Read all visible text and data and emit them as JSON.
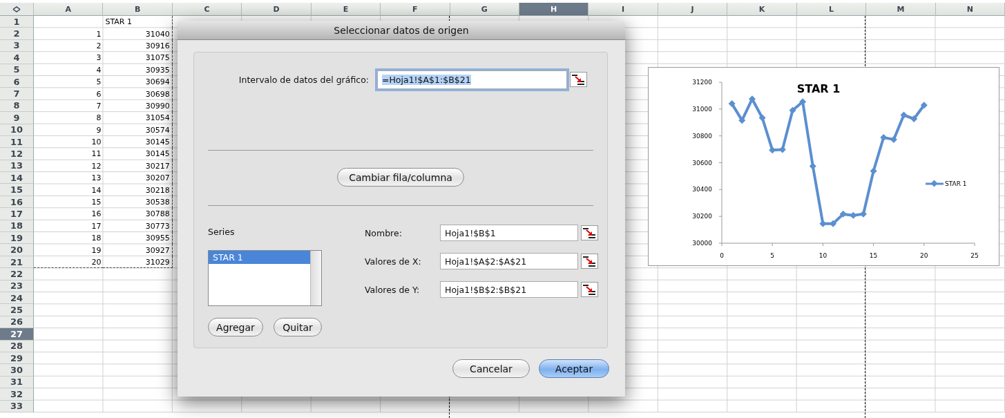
{
  "sheet": {
    "columns": [
      {
        "label": "A",
        "selected": false
      },
      {
        "label": "B",
        "selected": false
      },
      {
        "label": "C",
        "selected": false
      },
      {
        "label": "D",
        "selected": false
      },
      {
        "label": "E",
        "selected": false
      },
      {
        "label": "F",
        "selected": false
      },
      {
        "label": "G",
        "selected": false
      },
      {
        "label": "H",
        "selected": true
      },
      {
        "label": "I",
        "selected": false
      },
      {
        "label": "J",
        "selected": false
      },
      {
        "label": "K",
        "selected": false
      },
      {
        "label": "L",
        "selected": false
      },
      {
        "label": "M",
        "selected": false
      },
      {
        "label": "N",
        "selected": false
      }
    ],
    "rows": [
      {
        "label": "1",
        "selected": false,
        "b": "STAR 1"
      },
      {
        "label": "2",
        "selected": false,
        "a": "1",
        "b": "31040"
      },
      {
        "label": "3",
        "selected": false,
        "a": "2",
        "b": "30916"
      },
      {
        "label": "4",
        "selected": false,
        "a": "3",
        "b": "31075"
      },
      {
        "label": "5",
        "selected": false,
        "a": "4",
        "b": "30935"
      },
      {
        "label": "6",
        "selected": false,
        "a": "5",
        "b": "30694"
      },
      {
        "label": "7",
        "selected": false,
        "a": "6",
        "b": "30698"
      },
      {
        "label": "8",
        "selected": false,
        "a": "7",
        "b": "30990"
      },
      {
        "label": "9",
        "selected": false,
        "a": "8",
        "b": "31054"
      },
      {
        "label": "10",
        "selected": false,
        "a": "9",
        "b": "30574"
      },
      {
        "label": "11",
        "selected": false,
        "a": "10",
        "b": "30145"
      },
      {
        "label": "12",
        "selected": false,
        "a": "11",
        "b": "30145"
      },
      {
        "label": "13",
        "selected": false,
        "a": "12",
        "b": "30217"
      },
      {
        "label": "14",
        "selected": false,
        "a": "13",
        "b": "30207"
      },
      {
        "label": "15",
        "selected": false,
        "a": "14",
        "b": "30218"
      },
      {
        "label": "16",
        "selected": false,
        "a": "15",
        "b": "30538"
      },
      {
        "label": "17",
        "selected": false,
        "a": "16",
        "b": "30788"
      },
      {
        "label": "18",
        "selected": false,
        "a": "17",
        "b": "30773"
      },
      {
        "label": "19",
        "selected": false,
        "a": "18",
        "b": "30955"
      },
      {
        "label": "20",
        "selected": false,
        "a": "19",
        "b": "30927"
      },
      {
        "label": "21",
        "selected": false,
        "a": "20",
        "b": "31029"
      },
      {
        "label": "22",
        "selected": false
      },
      {
        "label": "23",
        "selected": false
      },
      {
        "label": "24",
        "selected": false
      },
      {
        "label": "25",
        "selected": false
      },
      {
        "label": "26",
        "selected": false
      },
      {
        "label": "27",
        "selected": true
      },
      {
        "label": "28",
        "selected": false
      },
      {
        "label": "29",
        "selected": false
      },
      {
        "label": "30",
        "selected": false
      },
      {
        "label": "31",
        "selected": false
      },
      {
        "label": "32",
        "selected": false
      },
      {
        "label": "33",
        "selected": false
      }
    ]
  },
  "chart": {
    "chart_data": {
      "type": "line",
      "title": "STAR 1",
      "x": [
        1,
        2,
        3,
        4,
        5,
        6,
        7,
        8,
        9,
        10,
        11,
        12,
        13,
        14,
        15,
        16,
        17,
        18,
        19,
        20
      ],
      "series": [
        {
          "name": "STAR 1",
          "color": "#5b8fd0",
          "marker": "diamond",
          "values": [
            31040,
            30916,
            31075,
            30935,
            30694,
            30698,
            30990,
            31054,
            30574,
            30145,
            30145,
            30217,
            30207,
            30218,
            30538,
            30788,
            30773,
            30955,
            30927,
            31029
          ]
        }
      ],
      "xlim": [
        0,
        25
      ],
      "ylim": [
        30000,
        31200
      ],
      "xticks": [
        0,
        5,
        10,
        15,
        20,
        25
      ],
      "yticks": [
        30000,
        30200,
        30400,
        30600,
        30800,
        31000,
        31200
      ]
    }
  },
  "dialog": {
    "title": "Seleccionar datos de origen",
    "range": {
      "label": "Intervalo de datos del gráfico:",
      "value": "=Hoja1!$A$1:$B$21",
      "text_selected": true
    },
    "switch_button": "Cambiar fila/columna",
    "series_label": "Series",
    "series": [
      {
        "label": "STAR 1",
        "selected": true
      }
    ],
    "fields": [
      {
        "label": "Nombre:",
        "value": "Hoja1!$B$1"
      },
      {
        "label": "Valores de X:",
        "value": "Hoja1!$A$2:$A$21"
      },
      {
        "label": "Valores de Y:",
        "value": "Hoja1!$B$2:$B$21"
      }
    ],
    "series_buttons": [
      "Agregar",
      "Quitar"
    ],
    "buttons": [
      {
        "label": "Cancelar",
        "default": false
      },
      {
        "label": "Aceptar",
        "default": true
      }
    ]
  }
}
